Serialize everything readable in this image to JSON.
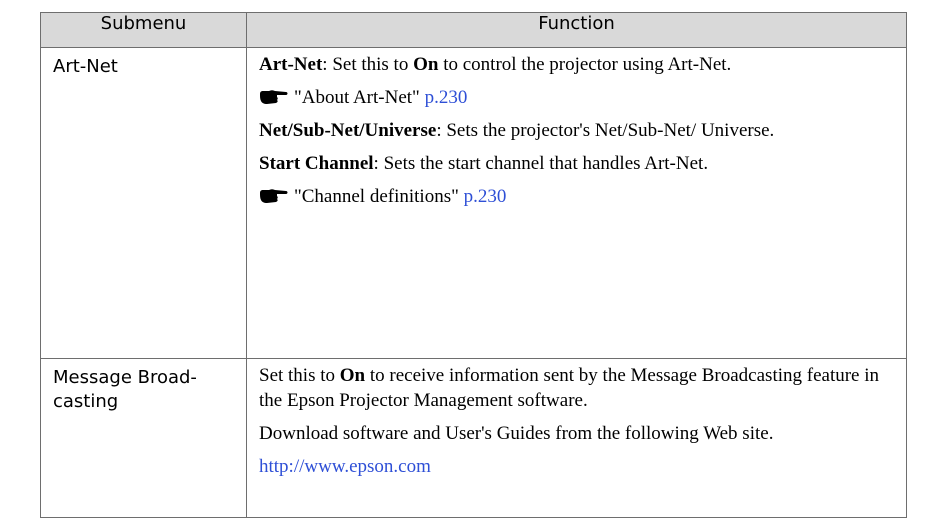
{
  "header": {
    "submenu": "Submenu",
    "function": "Function"
  },
  "rows": [
    {
      "submenu": "Art-Net",
      "artnet_term": "Art-Net",
      "artnet_text_1": ": Set this to ",
      "artnet_on": "On",
      "artnet_text_2": " to control the projector using Art-Net.",
      "ref1_text": "\"About Art-Net\" ",
      "ref1_page": "p.230",
      "net_term": "Net/Sub-Net/Universe",
      "net_text": ": Sets the projector's Net/Sub-Net/ Universe.",
      "start_term": "Start Channel",
      "start_text": ": Sets the start channel that handles Art-Net.",
      "ref2_text": "\"Channel definitions\" ",
      "ref2_page": "p.230"
    },
    {
      "submenu": "Message Broad-casting",
      "text_1": "Set this to ",
      "on": "On",
      "text_2": " to receive information sent by the Message Broadcasting feature in the Epson Projector Management software.",
      "download_text": "Download software and User's Guides from the following Web site.",
      "url": "http://www.epson.com"
    }
  ],
  "icons": {
    "reference": "pointing-hand-icon"
  },
  "colors": {
    "header_bg": "#d9d9d9",
    "link": "#2e4fd6",
    "border": "#6e6e6e"
  }
}
